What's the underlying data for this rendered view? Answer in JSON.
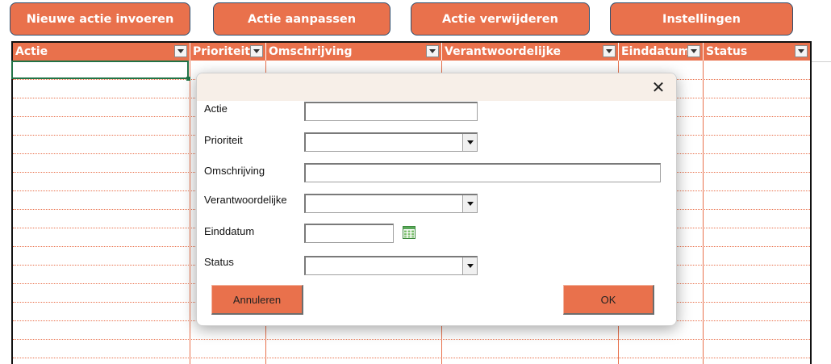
{
  "toolbar": {
    "buttons": [
      {
        "label": "Nieuwe actie invoeren"
      },
      {
        "label": "Actie aanpassen"
      },
      {
        "label": "Actie verwijderen"
      },
      {
        "label": "Instellingen"
      }
    ]
  },
  "table": {
    "headers": [
      "Actie",
      "Prioriteit",
      "Omschrijving",
      "Verantwoordelijke",
      "Einddatum",
      "Status"
    ]
  },
  "dialog": {
    "close_glyph": "✕",
    "fields": [
      {
        "label": "Actie",
        "value": ""
      },
      {
        "label": "Prioriteit",
        "value": ""
      },
      {
        "label": "Omschrijving",
        "value": ""
      },
      {
        "label": "Verantwoordelijke",
        "value": ""
      },
      {
        "label": "Einddatum",
        "value": ""
      },
      {
        "label": "Status",
        "value": ""
      }
    ],
    "cancel_label": "Annuleren",
    "ok_label": "OK"
  },
  "colors": {
    "accent": "#e9714c",
    "selection": "#217346"
  },
  "icons": {
    "filter": "chevron-down-icon",
    "close": "close-icon",
    "calendar": "calendar-icon"
  }
}
